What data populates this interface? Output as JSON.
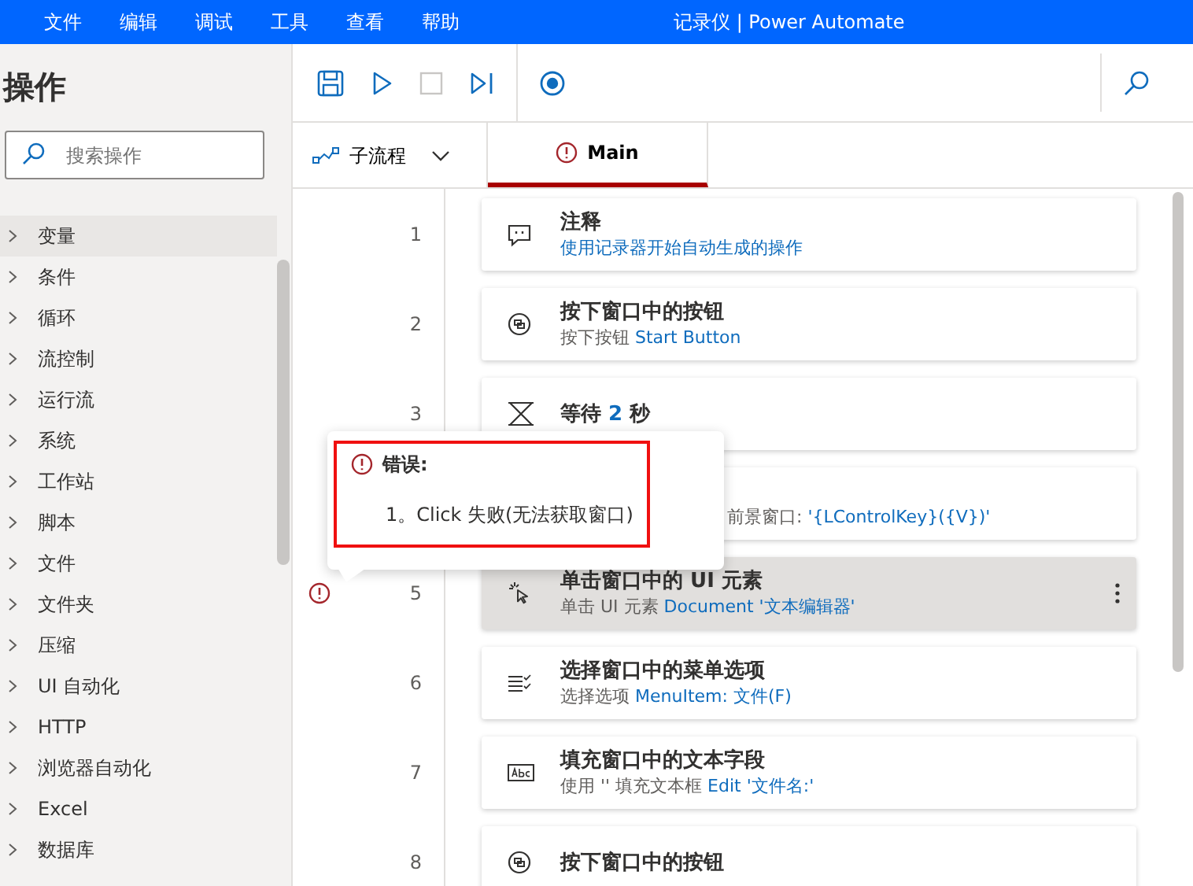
{
  "menu_bar": {
    "items": [
      "文件",
      "编辑",
      "调试",
      "工具",
      "查看",
      "帮助"
    ],
    "title": "记录仪 | Power Automate"
  },
  "actions_panel": {
    "title": "操作",
    "search": {
      "placeholder": "搜索操作"
    },
    "items": [
      {
        "label": "变量",
        "selected": true
      },
      {
        "label": "条件",
        "selected": false
      },
      {
        "label": "循环",
        "selected": false
      },
      {
        "label": "流控制",
        "selected": false
      },
      {
        "label": "运行流",
        "selected": false
      },
      {
        "label": "系统",
        "selected": false
      },
      {
        "label": "工作站",
        "selected": false
      },
      {
        "label": "脚本",
        "selected": false
      },
      {
        "label": "文件",
        "selected": false
      },
      {
        "label": "文件夹",
        "selected": false
      },
      {
        "label": "压缩",
        "selected": false
      },
      {
        "label": "UI 自动化",
        "selected": false
      },
      {
        "label": "HTTP",
        "selected": false
      },
      {
        "label": "浏览器自动化",
        "selected": false
      },
      {
        "label": "Excel",
        "selected": false
      },
      {
        "label": "数据库",
        "selected": false
      }
    ]
  },
  "toolbar": {
    "buttons": [
      {
        "kind": "save",
        "disabled": false
      },
      {
        "kind": "run",
        "disabled": false
      },
      {
        "kind": "stop",
        "disabled": true
      },
      {
        "kind": "step",
        "disabled": false
      },
      {
        "kind": "record",
        "disabled": false
      }
    ]
  },
  "subflows": {
    "label": "子流程"
  },
  "tabs": [
    {
      "label": "Main",
      "selected": true,
      "error": true
    }
  ],
  "steps": [
    {
      "number": "1",
      "kind": "comment",
      "title": [
        {
          "text": "注释",
          "kind": "plain"
        }
      ],
      "subtitle": [
        {
          "text": "使用记录器开始自动生成的操作",
          "kind": "value"
        }
      ],
      "selected": false,
      "error": false
    },
    {
      "number": "2",
      "kind": "button",
      "title": [
        {
          "text": "按下窗口中的按钮",
          "kind": "plain"
        }
      ],
      "subtitle": [
        {
          "text": "按下按钮",
          "kind": "plain"
        },
        {
          "text": "Start Button",
          "kind": "value"
        }
      ],
      "selected": false,
      "error": false
    },
    {
      "number": "3",
      "kind": "wait",
      "title": [
        {
          "text": "等待",
          "kind": "plain"
        },
        {
          "text": "2",
          "kind": "value"
        },
        {
          "text": "秒",
          "kind": "plain"
        }
      ],
      "selected": false,
      "error": false
    },
    {
      "kind": "keys",
      "subtitle": [
        {
          "text": "前景窗口:",
          "kind": "plain"
        },
        {
          "text": "'{LControlKey}({V})'",
          "kind": "value"
        }
      ],
      "selected": false,
      "error": false
    },
    {
      "number": "5",
      "kind": "click",
      "title": [
        {
          "text": "单击窗口中的 UI 元素",
          "kind": "plain"
        }
      ],
      "subtitle": [
        {
          "text": "单击 UI 元素",
          "kind": "plain"
        },
        {
          "text": "Document '文本编辑器'",
          "kind": "value"
        }
      ],
      "selected": true,
      "error": true
    },
    {
      "number": "6",
      "kind": "menu",
      "title": [
        {
          "text": "选择窗口中的菜单选项",
          "kind": "plain"
        }
      ],
      "subtitle": [
        {
          "text": "选择选项",
          "kind": "plain"
        },
        {
          "text": "MenuItem: 文件(F)",
          "kind": "value"
        }
      ],
      "selected": false,
      "error": false
    },
    {
      "number": "7",
      "kind": "textfield",
      "title": [
        {
          "text": "填充窗口中的文本字段",
          "kind": "plain"
        }
      ],
      "subtitle": [
        {
          "text": "使用 '' 填充文本框",
          "kind": "plain"
        },
        {
          "text": "Edit '文件名:'",
          "kind": "value"
        }
      ],
      "selected": false,
      "error": false
    },
    {
      "number": "8",
      "kind": "button",
      "title": [
        {
          "text": "按下窗口中的按钮",
          "kind": "plain"
        }
      ],
      "selected": false,
      "error": false
    }
  ],
  "error_tooltip": {
    "title": "错误:",
    "messages": [
      "1。Click 失败(无法获取窗口)"
    ]
  }
}
